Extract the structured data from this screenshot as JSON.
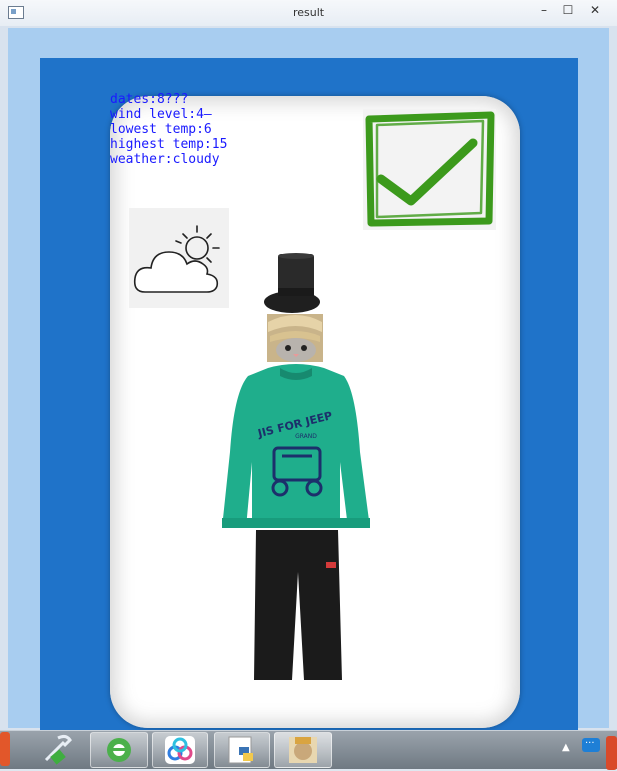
{
  "window": {
    "title": "result"
  },
  "info": {
    "dates": "dates:8???",
    "wind": "wind level:4—",
    "lowest": "lowest temp:6",
    "highest": "highest temp:15",
    "weather": "weather:cloudy"
  },
  "shirt_text": {
    "line1": "JIS FOR JEEP",
    "line2": "GRAND"
  },
  "colors": {
    "background_blue": "#1f73c9",
    "info_text": "#1a1aff",
    "check_green": "#3c9a1c",
    "shirt_green": "#1fae8c",
    "pants": "#1b1b1b"
  },
  "icons": {
    "weather": "cloud-sun-icon",
    "status": "checkmark-icon",
    "taskbar": [
      "app-icon-red",
      "tools-icon",
      "ie-browser-icon",
      "baidu-netdisk-icon",
      "python-file-icon",
      "avatar-app-icon"
    ]
  }
}
